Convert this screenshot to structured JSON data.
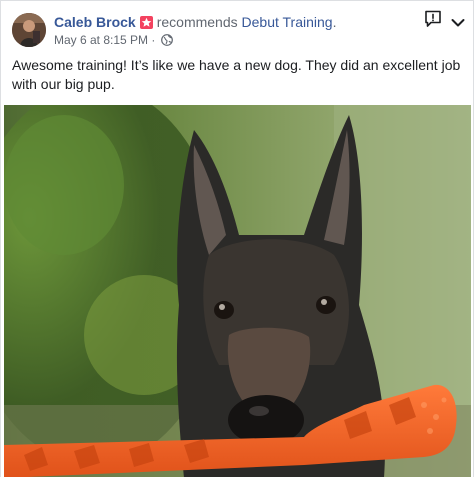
{
  "post": {
    "author_name": "Caleb Brock",
    "verb": "recommends",
    "page_name": "Debut Training",
    "page_suffix": ".",
    "timestamp": "May 6 at 8:15 PM",
    "separator": "·",
    "audience_icon": "globe-icon",
    "text": "Awesome training! It’s like we have a new dog. They did an excellent job with our big pup.",
    "badge_icon": "star-recommend-icon",
    "report_icon": "report-flag-icon",
    "menu_icon": "chevron-down-icon"
  },
  "colors": {
    "link": "#385898",
    "meta": "#616770",
    "badge": "#f3425f",
    "text": "#1c1e21"
  }
}
